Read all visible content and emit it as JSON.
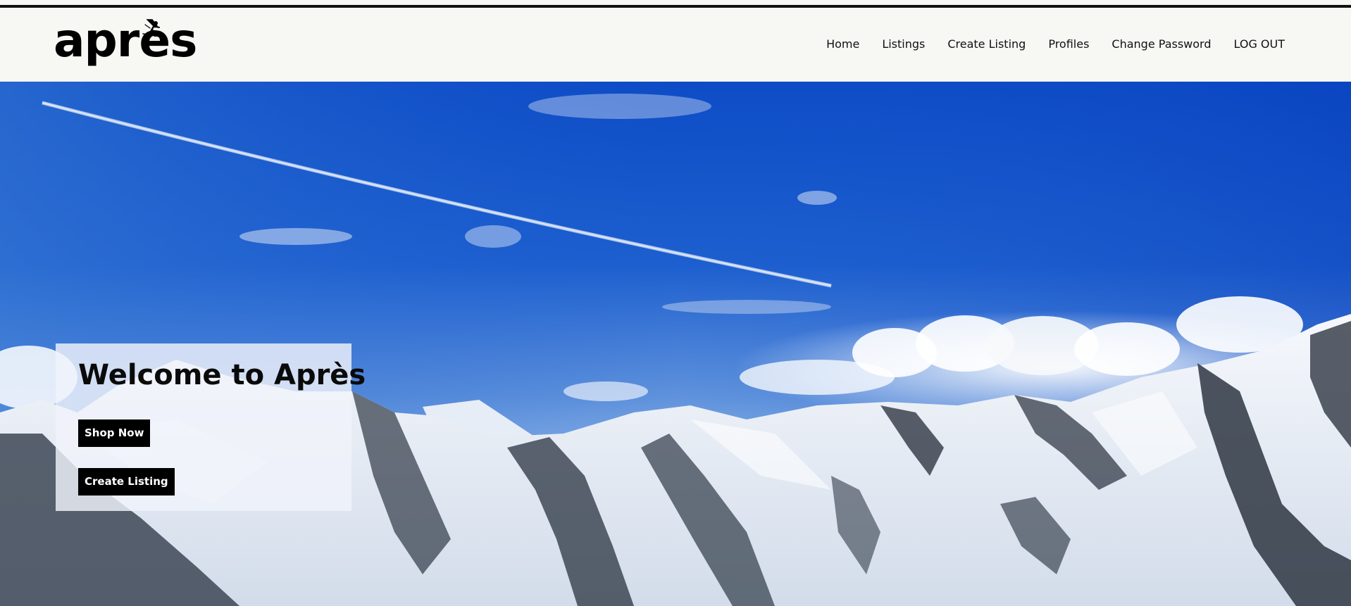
{
  "brand": {
    "logo_text": "après",
    "logo_icon": "skier-icon"
  },
  "nav": {
    "items": [
      {
        "label": "Home"
      },
      {
        "label": "Listings"
      },
      {
        "label": "Create Listing"
      },
      {
        "label": "Profiles"
      },
      {
        "label": "Change Password"
      },
      {
        "label": "LOG OUT"
      }
    ]
  },
  "hero": {
    "background": "snowy mountain range under blue sky",
    "title": "Welcome to Après",
    "buttons": {
      "shop_now": "Shop Now",
      "create_listing": "Create Listing"
    }
  },
  "colors": {
    "header_bg": "#f7f7f4",
    "sky_top": "#0a48c4",
    "sky_bottom": "#9cc2ea",
    "button_bg": "#000000",
    "button_text": "#ffffff"
  }
}
